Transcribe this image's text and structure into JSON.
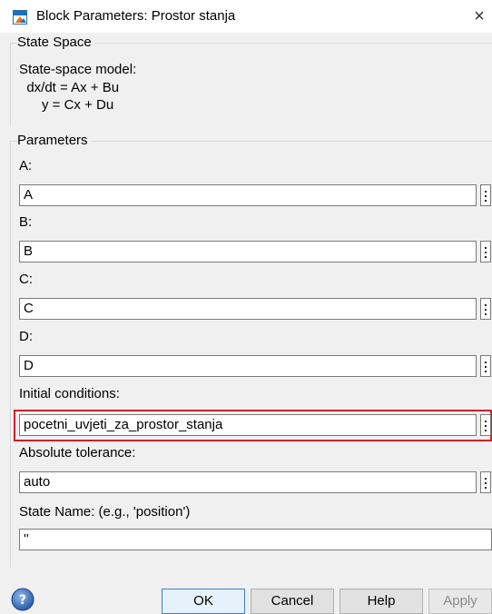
{
  "window": {
    "title": "Block Parameters: Prostor stanja",
    "close_glyph": "×",
    "app_icon": "simulink-block-icon",
    "close_icon": "close-icon"
  },
  "state_space": {
    "group_label": "State Space",
    "description_line1": "State-space model:",
    "description_line2": "  dx/dt = Ax + Bu",
    "description_line3": "      y = Cx + Du"
  },
  "parameters": {
    "group_label": "Parameters",
    "fields": [
      {
        "label": "A:",
        "value": "A"
      },
      {
        "label": "B:",
        "value": "B"
      },
      {
        "label": "C:",
        "value": "C"
      },
      {
        "label": "D:",
        "value": "D"
      },
      {
        "label": "Initial conditions:",
        "value": "pocetni_uvjeti_za_prostor_stanja"
      },
      {
        "label": "Absolute tolerance:",
        "value": "auto"
      },
      {
        "label": "State Name: (e.g., 'position')",
        "value": "''"
      }
    ]
  },
  "buttons": {
    "ok": "OK",
    "cancel": "Cancel",
    "help": "Help",
    "apply": "Apply"
  },
  "colors": {
    "highlight_border": "#d0202a",
    "ok_border": "#3c7fd0",
    "dialog_background": "#f0f0f0"
  }
}
